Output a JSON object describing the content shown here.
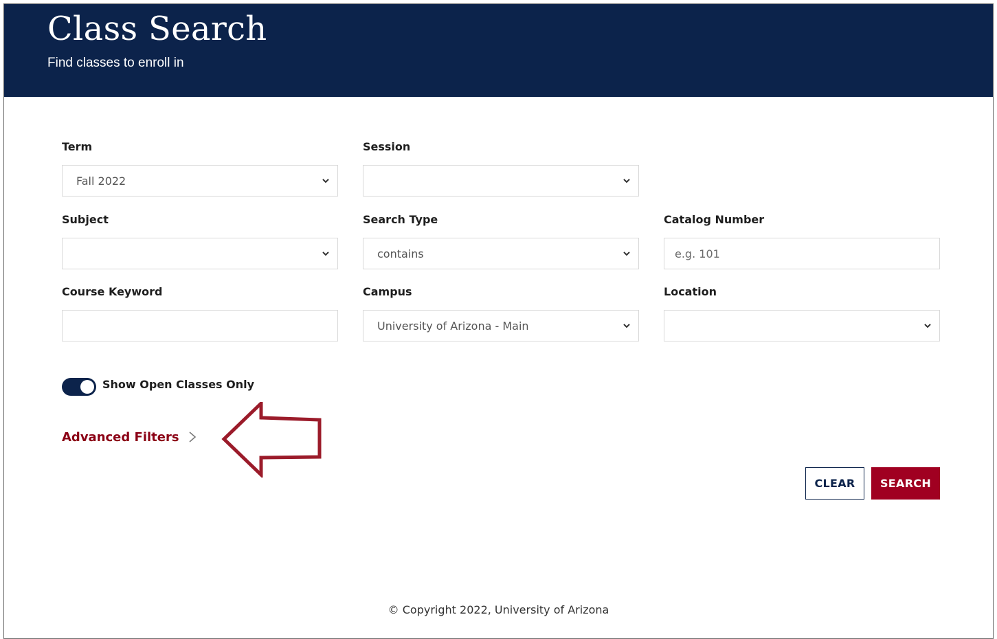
{
  "header": {
    "title": "Class Search",
    "subtitle": "Find classes to enroll in"
  },
  "form": {
    "term": {
      "label": "Term",
      "value": "Fall 2022"
    },
    "session": {
      "label": "Session",
      "value": ""
    },
    "subject": {
      "label": "Subject",
      "value": ""
    },
    "search_type": {
      "label": "Search Type",
      "value": "contains"
    },
    "catalog_number": {
      "label": "Catalog Number",
      "value": "",
      "placeholder": "e.g. 101"
    },
    "course_keyword": {
      "label": "Course Keyword",
      "value": ""
    },
    "campus": {
      "label": "Campus",
      "value": "University of Arizona - Main"
    },
    "location": {
      "label": "Location",
      "value": ""
    },
    "open_classes_toggle": {
      "label": "Show Open Classes Only",
      "checked": true
    }
  },
  "advanced_filters": {
    "label": "Advanced Filters"
  },
  "buttons": {
    "clear": "CLEAR",
    "search": "SEARCH"
  },
  "footer": {
    "copyright": "© Copyright 2022, University of Arizona"
  },
  "colors": {
    "header_bg": "#0c234b",
    "accent_red": "#a00021",
    "link_red": "#8b0015",
    "annotation_arrow": "#9b1b2a"
  },
  "icons": {
    "select_chevron": "chevron-down-icon",
    "advanced_chevron": "chevron-right-icon",
    "annotation": "arrow-left-icon"
  }
}
